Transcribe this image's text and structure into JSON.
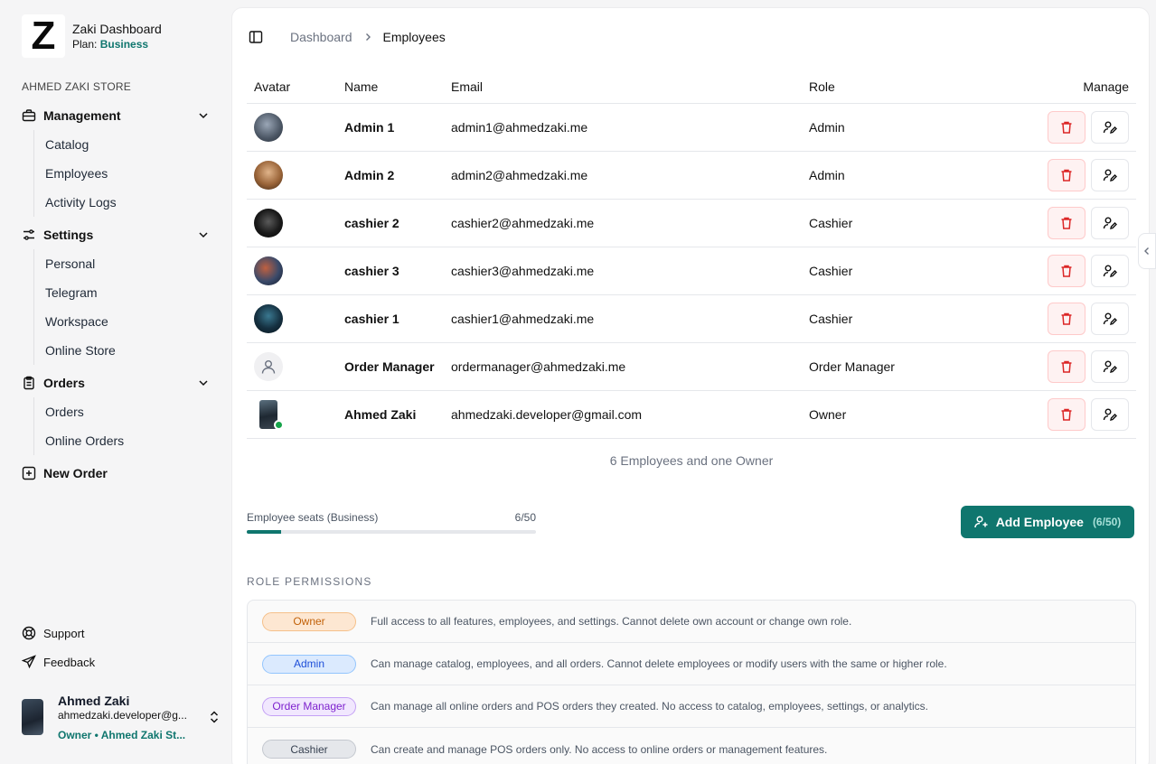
{
  "brand": {
    "logo": "Z",
    "title": "Zaki Dashboard",
    "plan_label": "Plan:",
    "plan_value": "Business"
  },
  "store_label": "AHMED ZAKI STORE",
  "nav": {
    "management": {
      "label": "Management",
      "items": [
        "Catalog",
        "Employees",
        "Activity Logs"
      ]
    },
    "settings": {
      "label": "Settings",
      "items": [
        "Personal",
        "Telegram",
        "Workspace",
        "Online Store"
      ]
    },
    "orders": {
      "label": "Orders",
      "items": [
        "Orders",
        "Online Orders"
      ]
    },
    "new_order": "New Order"
  },
  "footer": {
    "support": "Support",
    "feedback": "Feedback"
  },
  "user": {
    "name": "Ahmed Zaki",
    "email": "ahmedzaki.developer@g...",
    "role": "Owner • Ahmed Zaki St..."
  },
  "breadcrumb": {
    "parent": "Dashboard",
    "current": "Employees"
  },
  "table": {
    "headers": {
      "avatar": "Avatar",
      "name": "Name",
      "email": "Email",
      "role": "Role",
      "manage": "Manage"
    },
    "rows": [
      {
        "name": "Admin 1",
        "email": "admin1@ahmedzaki.me",
        "role": "Admin"
      },
      {
        "name": "Admin 2",
        "email": "admin2@ahmedzaki.me",
        "role": "Admin"
      },
      {
        "name": "cashier 2",
        "email": "cashier2@ahmedzaki.me",
        "role": "Cashier"
      },
      {
        "name": "cashier 3",
        "email": "cashier3@ahmedzaki.me",
        "role": "Cashier"
      },
      {
        "name": "cashier 1",
        "email": "cashier1@ahmedzaki.me",
        "role": "Cashier"
      },
      {
        "name": "Order Manager",
        "email": "ordermanager@ahmedzaki.me",
        "role": "Order Manager"
      },
      {
        "name": "Ahmed Zaki",
        "email": "ahmedzaki.developer@gmail.com",
        "role": "Owner"
      }
    ]
  },
  "summary": "6 Employees and one Owner",
  "seats": {
    "label": "Employee seats (Business)",
    "count": "6/50",
    "fraction": 0.12
  },
  "add_button": {
    "label": "Add Employee",
    "count": "(6/50)"
  },
  "permissions": {
    "title": "ROLE PERMISSIONS",
    "rows": [
      {
        "role": "Owner",
        "desc": "Full access to all features, employees, and settings. Cannot delete own account or change own role."
      },
      {
        "role": "Admin",
        "desc": "Can manage catalog, employees, and all orders. Cannot delete employees or modify users with the same or higher role."
      },
      {
        "role": "Order Manager",
        "desc": "Can manage all online orders and POS orders they created. No access to catalog, employees, settings, or analytics."
      },
      {
        "role": "Cashier",
        "desc": "Can create and manage POS orders only. No access to online orders or management features."
      }
    ]
  },
  "colors": {
    "accent": "#0f766e",
    "danger": "#dc2626",
    "owner_pill": "#fde7d2",
    "admin_pill": "#dbeafe",
    "order_manager_pill": "#f1e7fe",
    "cashier_pill": "#e5e7eb"
  }
}
